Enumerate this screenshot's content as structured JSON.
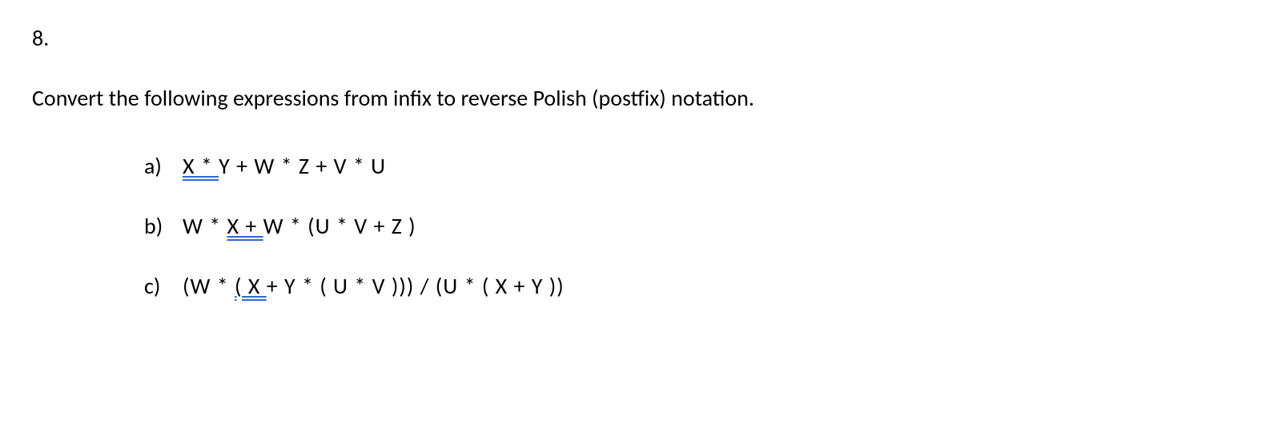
{
  "question": {
    "number": "8.",
    "prompt": "Convert the following expressions from infix to reverse Polish (postfix) notation.",
    "items": [
      {
        "label": "a)",
        "underlined": "X * ",
        "rest": "Y + W * Z + V * U"
      },
      {
        "label": "b)",
        "preUnderline": "W * ",
        "underlined": "X + ",
        "rest": "W * (U * V + Z )"
      },
      {
        "label": "c)",
        "preUnderline": "(W * ",
        "underlined": "( X ",
        "rest": "+ Y * ( U * V ))) / (U * ( X + Y ))"
      }
    ]
  }
}
